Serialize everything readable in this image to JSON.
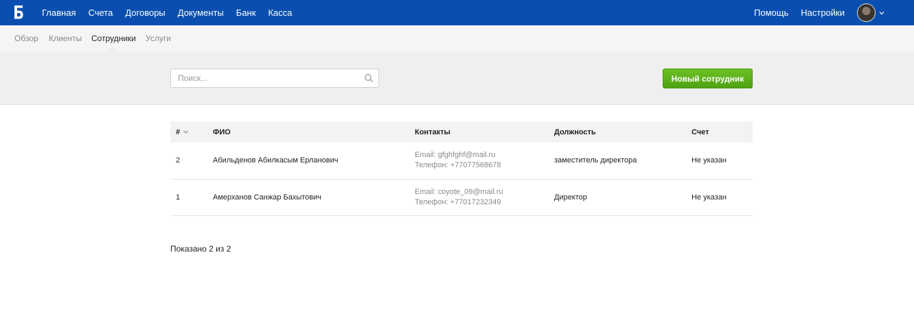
{
  "topnav": {
    "logo_icon": "logo-b-icon",
    "items": [
      "Главная",
      "Счета",
      "Договоры",
      "Документы",
      "Банк",
      "Касса"
    ],
    "help": "Помощь",
    "settings": "Настройки"
  },
  "subnav": {
    "items": [
      "Обзор",
      "Клиенты",
      "Сотрудники",
      "Услуги"
    ],
    "active": "Сотрудники"
  },
  "search": {
    "placeholder": "Поиск...",
    "value": ""
  },
  "new_button": "Новый сотрудник",
  "table": {
    "headers": [
      "#",
      "ФИО",
      "Контакты",
      "Должность",
      "Счет"
    ],
    "rows": [
      {
        "num": "2",
        "name": "Абильденов Абилкасым Ерланович",
        "email": "Email: gfghfghf@mail.ru",
        "phone": "Телефон: +77077568678",
        "position": "заместитель директора",
        "account": "Не указан"
      },
      {
        "num": "1",
        "name": "Амерханов Санжар Бахытович",
        "email": "Email: coyote_09@mail.ru",
        "phone": "Телефон: +77017232349",
        "position": "Директор",
        "account": "Не указан"
      }
    ]
  },
  "footer": {
    "shown": "Показано 2 из 2"
  },
  "colors": {
    "topbar": "#0a4fb0",
    "button": "#5cb01a"
  }
}
